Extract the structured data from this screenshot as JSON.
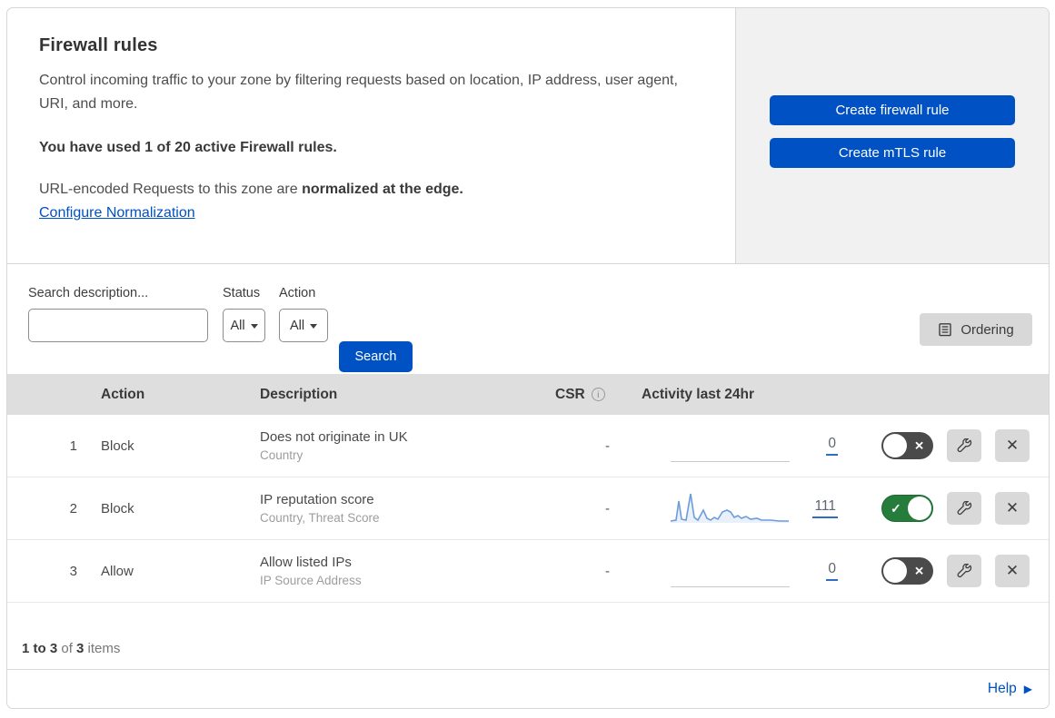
{
  "header": {
    "title": "Firewall rules",
    "description": "Control incoming traffic to your zone by filtering requests based on location, IP address, user agent, URI, and more.",
    "usage": "You have used 1 of 20 active Firewall rules.",
    "normalization_prefix": "URL-encoded Requests to this zone are ",
    "normalization_bold": "normalized at the edge.",
    "normalization_link": "Configure Normalization",
    "buttons": {
      "create_firewall_rule": "Create firewall rule",
      "create_mtls_rule": "Create mTLS rule"
    }
  },
  "filters": {
    "search_label": "Search description...",
    "status_label": "Status",
    "status_value": "All",
    "action_label": "Action",
    "action_value": "All",
    "search_button": "Search",
    "ordering_button": "Ordering"
  },
  "table": {
    "columns": {
      "action": "Action",
      "description": "Description",
      "csr": "CSR",
      "activity": "Activity last 24hr"
    }
  },
  "rules": [
    {
      "number": "1",
      "action": "Block",
      "description": "Does not originate in UK",
      "fields": "Country",
      "csr": "-",
      "activity_count": "0",
      "enabled": false,
      "sparkline": null
    },
    {
      "number": "2",
      "action": "Block",
      "description": "IP reputation score",
      "fields": "Country, Threat Score",
      "csr": "-",
      "activity_count": "111",
      "enabled": true,
      "sparkline": [
        [
          0,
          34
        ],
        [
          6,
          33
        ],
        [
          9,
          12
        ],
        [
          12,
          32
        ],
        [
          17,
          33
        ],
        [
          22,
          4
        ],
        [
          26,
          30
        ],
        [
          30,
          33
        ],
        [
          36,
          22
        ],
        [
          40,
          31
        ],
        [
          44,
          33
        ],
        [
          48,
          30
        ],
        [
          52,
          32
        ],
        [
          57,
          24
        ],
        [
          62,
          22
        ],
        [
          66,
          24
        ],
        [
          70,
          30
        ],
        [
          74,
          28
        ],
        [
          78,
          31
        ],
        [
          83,
          29
        ],
        [
          88,
          32
        ],
        [
          95,
          31
        ],
        [
          100,
          33
        ],
        [
          110,
          33
        ],
        [
          120,
          34
        ],
        [
          130,
          34
        ]
      ]
    },
    {
      "number": "3",
      "action": "Allow",
      "description": "Allow listed IPs",
      "fields": "IP Source Address",
      "csr": "-",
      "activity_count": "0",
      "enabled": false,
      "sparkline": null
    }
  ],
  "footer": {
    "range": "1 to 3",
    "of_text": " of ",
    "total": "3",
    "items_text": " items",
    "help": "Help"
  },
  "colors": {
    "accent_blue": "#0051c3",
    "toggle_green": "#267d3b",
    "toggle_off_gray": "#4a4a4a",
    "sparkline_blue": "#6d9cdb",
    "table_header_gray": "#dedede",
    "panel_gray": "#f1f1f1"
  }
}
